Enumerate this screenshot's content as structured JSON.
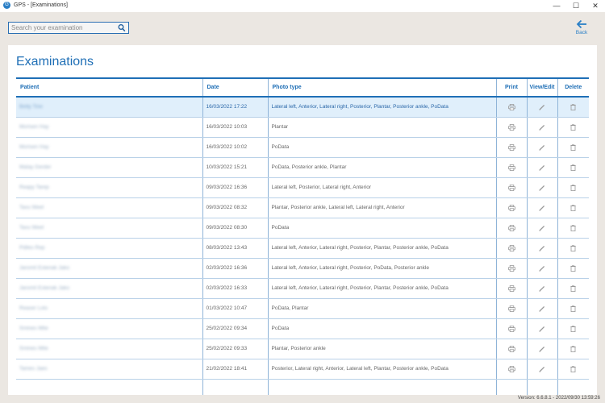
{
  "window": {
    "title": "GPS - [Examinations]",
    "minimize": "—",
    "maximize": "☐",
    "close": "✕",
    "app_icon": "G"
  },
  "search": {
    "placeholder": "Search your examination",
    "value": ""
  },
  "back": {
    "label": "Back",
    "icon": "arrow-left-icon"
  },
  "page": {
    "title": "Examinations"
  },
  "table": {
    "columns": {
      "patient": "Patient",
      "date": "Date",
      "photo_type": "Photo type",
      "print": "Print",
      "view_edit": "View/Edit",
      "delete": "Delete"
    },
    "rows": [
      {
        "patient": "Betty Tine",
        "date": "16/03/2022 17:22",
        "photo_type": "Lateral left, Anterior, Lateral right, Posterior, Plantar, Posterior ankle, PoData"
      },
      {
        "patient": "Morisen Hay",
        "date": "16/03/2022 10:03",
        "photo_type": "Plantar"
      },
      {
        "patient": "Morisen Hay",
        "date": "16/03/2022 10:02",
        "photo_type": "PoData"
      },
      {
        "patient": "Malay Gerder",
        "date": "10/03/2022 15:21",
        "photo_type": "PoData, Posterior ankle, Plantar"
      },
      {
        "patient": "Reapy Tarep",
        "date": "09/03/2022 16:36",
        "photo_type": "Lateral left, Posterior, Lateral right, Anterior"
      },
      {
        "patient": "Tavu Weel",
        "date": "09/03/2022 08:32",
        "photo_type": "Plantar, Posterior ankle, Lateral left, Lateral right, Anterior"
      },
      {
        "patient": "Tavu Weel",
        "date": "09/03/2022 08:30",
        "photo_type": "PoData"
      },
      {
        "patient": "Pdiles Rep",
        "date": "08/03/2022 13:43",
        "photo_type": "Lateral left, Anterior, Lateral right, Posterior, Plantar, Posterior ankle, PoData"
      },
      {
        "patient": "Jaromit Estenak Jako",
        "date": "02/03/2022 16:36",
        "photo_type": "Lateral left, Anterior, Lateral right, Posterior, PoData, Posterior ankle"
      },
      {
        "patient": "Jaromit Estenak Jako",
        "date": "02/03/2022 16:33",
        "photo_type": "Lateral left, Anterior, Lateral right, Posterior, Plantar, Posterior ankle, PoData"
      },
      {
        "patient": "Reaser Lolo",
        "date": "01/03/2022 10:47",
        "photo_type": "PoData, Plantar"
      },
      {
        "patient": "Smines Mite",
        "date": "25/02/2022 09:34",
        "photo_type": "PoData"
      },
      {
        "patient": "Smines Mite",
        "date": "25/02/2022 09:33",
        "photo_type": "Plantar, Posterior ankle"
      },
      {
        "patient": "Tames Jaes",
        "date": "21/02/2022 18:41",
        "photo_type": "Posterior, Lateral right, Anterior, Lateral left, Plantar, Posterior ankle, PoData"
      },
      {
        "patient": "",
        "date": "",
        "photo_type": ""
      }
    ]
  },
  "status": {
    "version": "Version: 6.6.8.1 - 2022/09/30 13:59:26"
  }
}
